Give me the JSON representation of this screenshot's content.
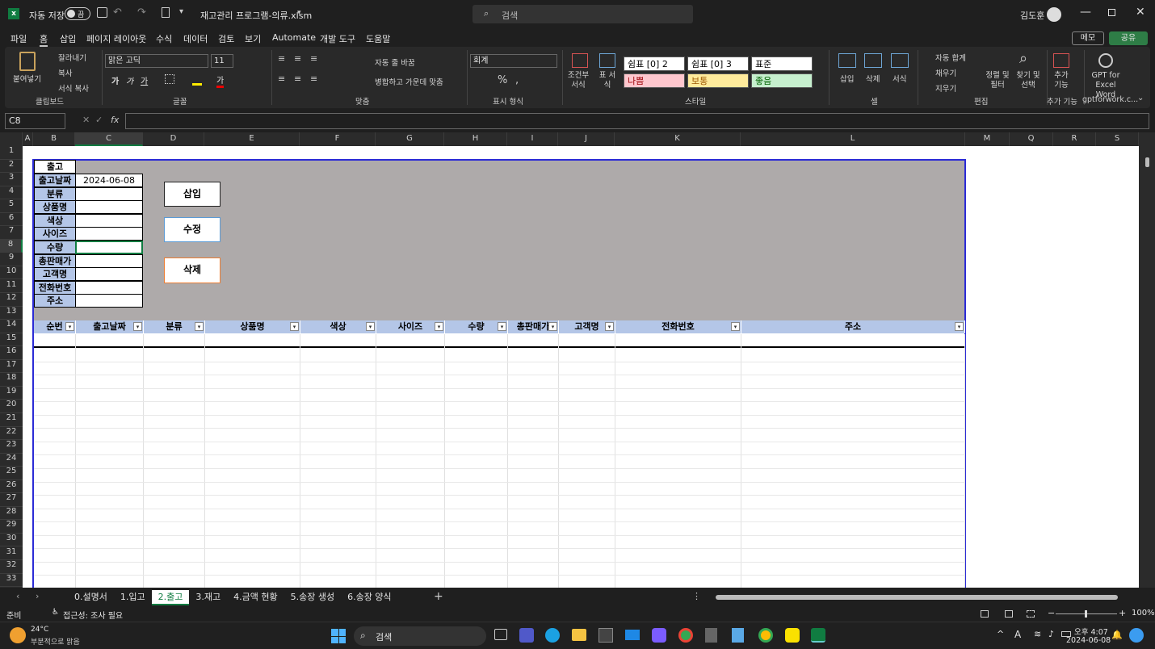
{
  "title": {
    "autosave": "자동 저장",
    "toggle": "끔",
    "filename": "재고관리 프로그램-의류.xlsm",
    "search": "검색",
    "user": "김도훈"
  },
  "menu": [
    "파일",
    "홈",
    "삽입",
    "페이지 레이아웃",
    "수식",
    "데이터",
    "검토",
    "보기",
    "Automate",
    "개발 도구",
    "도움말"
  ],
  "menu_right": {
    "memo": "메모",
    "share": "공유"
  },
  "ribbon": {
    "paste": "붙여넣기",
    "cut": "잘라내기",
    "copy": "복사",
    "format_painter": "서식 복사",
    "clipboard": "클립보드",
    "font_name": "맑은 고딕",
    "font_size": "11",
    "font_group": "글꼴",
    "wrap": "자동 줄 바꿈",
    "merge": "병합하고 가운데 맞춤",
    "align_group": "맞춤",
    "number_format": "회계",
    "number_group": "표시 형식",
    "cond_format": "조건부 서식",
    "table_format": "표 서식",
    "styles": [
      "쉼표 [0] 2",
      "쉼표 [0] 3",
      "표준",
      "나쁨",
      "보통",
      "좋음"
    ],
    "style_group": "스타일",
    "insert": "삽입",
    "delete": "삭제",
    "format": "서식",
    "cells_group": "셀",
    "autosum": "자동 합계",
    "fill": "채우기",
    "clear": "지우기",
    "sort": "정렬 및 필터",
    "find": "찾기 및 선택",
    "edit_group": "편집",
    "addins": "추가 기능",
    "addins_group": "추가 기능",
    "gpt": "GPT for Excel Word",
    "gpt_group": "gptforwork.c..."
  },
  "formula": {
    "namebox": "C8",
    "fx": "fx",
    "value": ""
  },
  "columns": [
    "A",
    "B",
    "C",
    "D",
    "E",
    "F",
    "G",
    "H",
    "I",
    "J",
    "K",
    "L",
    "M",
    "Q",
    "R",
    "S"
  ],
  "rows": [
    "1",
    "2",
    "3",
    "4",
    "5",
    "6",
    "7",
    "8",
    "9",
    "10",
    "11",
    "12",
    "13",
    "14",
    "15",
    "16",
    "17",
    "18",
    "19",
    "20",
    "21",
    "22",
    "23",
    "24",
    "25",
    "26",
    "27",
    "28",
    "29",
    "30",
    "31",
    "32",
    "33"
  ],
  "form": {
    "header": "출고",
    "labels": [
      "출고날짜",
      "분류",
      "상품명",
      "색상",
      "사이즈",
      "수량",
      "총판매가",
      "고객명",
      "전화번호",
      "주소"
    ],
    "date_value": "2024-06-08"
  },
  "buttons": {
    "insert": "삽입",
    "edit": "수정",
    "delete": "삭제"
  },
  "table_headers": [
    "순번",
    "출고날짜",
    "분류",
    "상품명",
    "색상",
    "사이즈",
    "수량",
    "총판매가",
    "고객명",
    "전화번호",
    "주소"
  ],
  "sheets": [
    "0.설명서",
    "1.입고",
    "2.출고",
    "3.재고",
    "4.금액 현황",
    "5.송장 생성",
    "6.송장 양식"
  ],
  "status": {
    "ready": "준비",
    "accessibility": "접근성: 조사 필요",
    "zoom": "100%"
  },
  "taskbar": {
    "temp": "24°C",
    "weather": "부분적으로 맑음",
    "search": "검색",
    "time": "오후 4:07",
    "date": "2024-06-08"
  }
}
